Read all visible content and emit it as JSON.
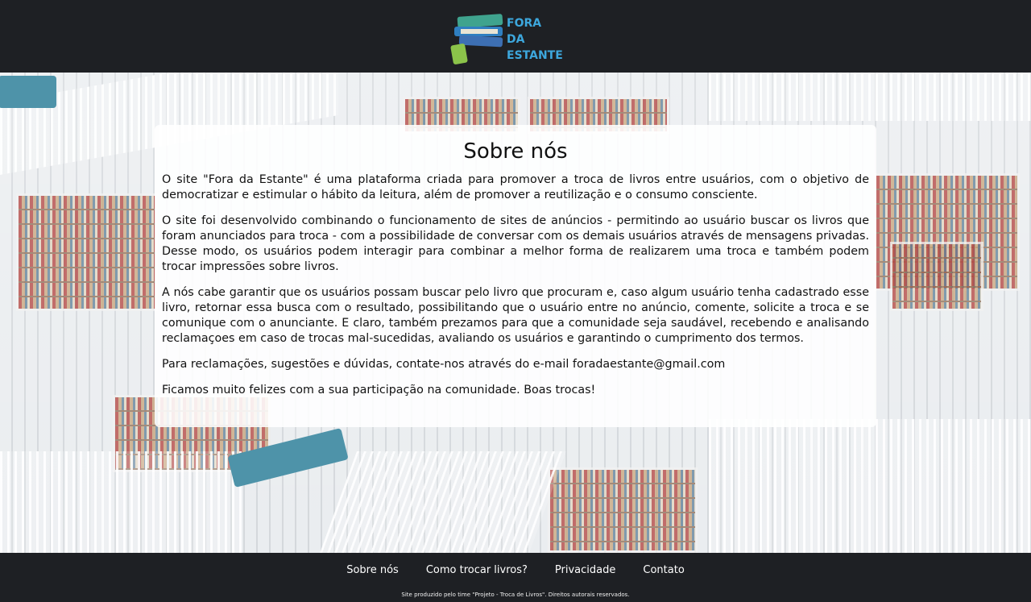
{
  "header": {
    "logo_line1": "FORA",
    "logo_line2": "DA ESTANTE"
  },
  "about": {
    "title": "Sobre nós",
    "paragraphs": [
      "O site \"Fora da Estante\" é uma plataforma criada para promover a troca de livros entre usuários, com o objetivo de democratizar e estimular o hábito da leitura, além de promover a reutilização e o consumo consciente.",
      "O site foi desenvolvido combinando o funcionamento de sites de anúncios - permitindo ao usuário buscar os livros que foram anunciados para troca - com a possibilidade de conversar com os demais usuários através de mensagens privadas. Desse modo, os usuários podem interagir para combinar a melhor forma de realizarem uma troca e também podem trocar impressões sobre livros.",
      "A nós cabe garantir que os usuários possam buscar pelo livro que procuram e, caso algum usuário tenha cadastrado esse livro, retornar essa busca com o resultado, possibilitando que o usuário entre no anúncio, comente, solicite a troca e se comunique com o anunciante. E claro, também prezamos para que a comunidade seja saudável, recebendo e analisando reclamaçoes em caso de trocas mal-sucedidas, avaliando os usuários e garantindo o cumprimento dos termos.",
      "Para reclamações, sugestões e dúvidas, contate-nos através do e-mail foradaestante@gmail.com",
      "Ficamos muito felizes com a sua participação na comunidade. Boas trocas!"
    ]
  },
  "footer": {
    "nav": [
      "Sobre nós",
      "Como trocar livros?",
      "Privacidade",
      "Contato"
    ],
    "copyright": "Site produzido pelo time \"Projeto - Troca de Livros\". Direitos autorais reservados."
  }
}
